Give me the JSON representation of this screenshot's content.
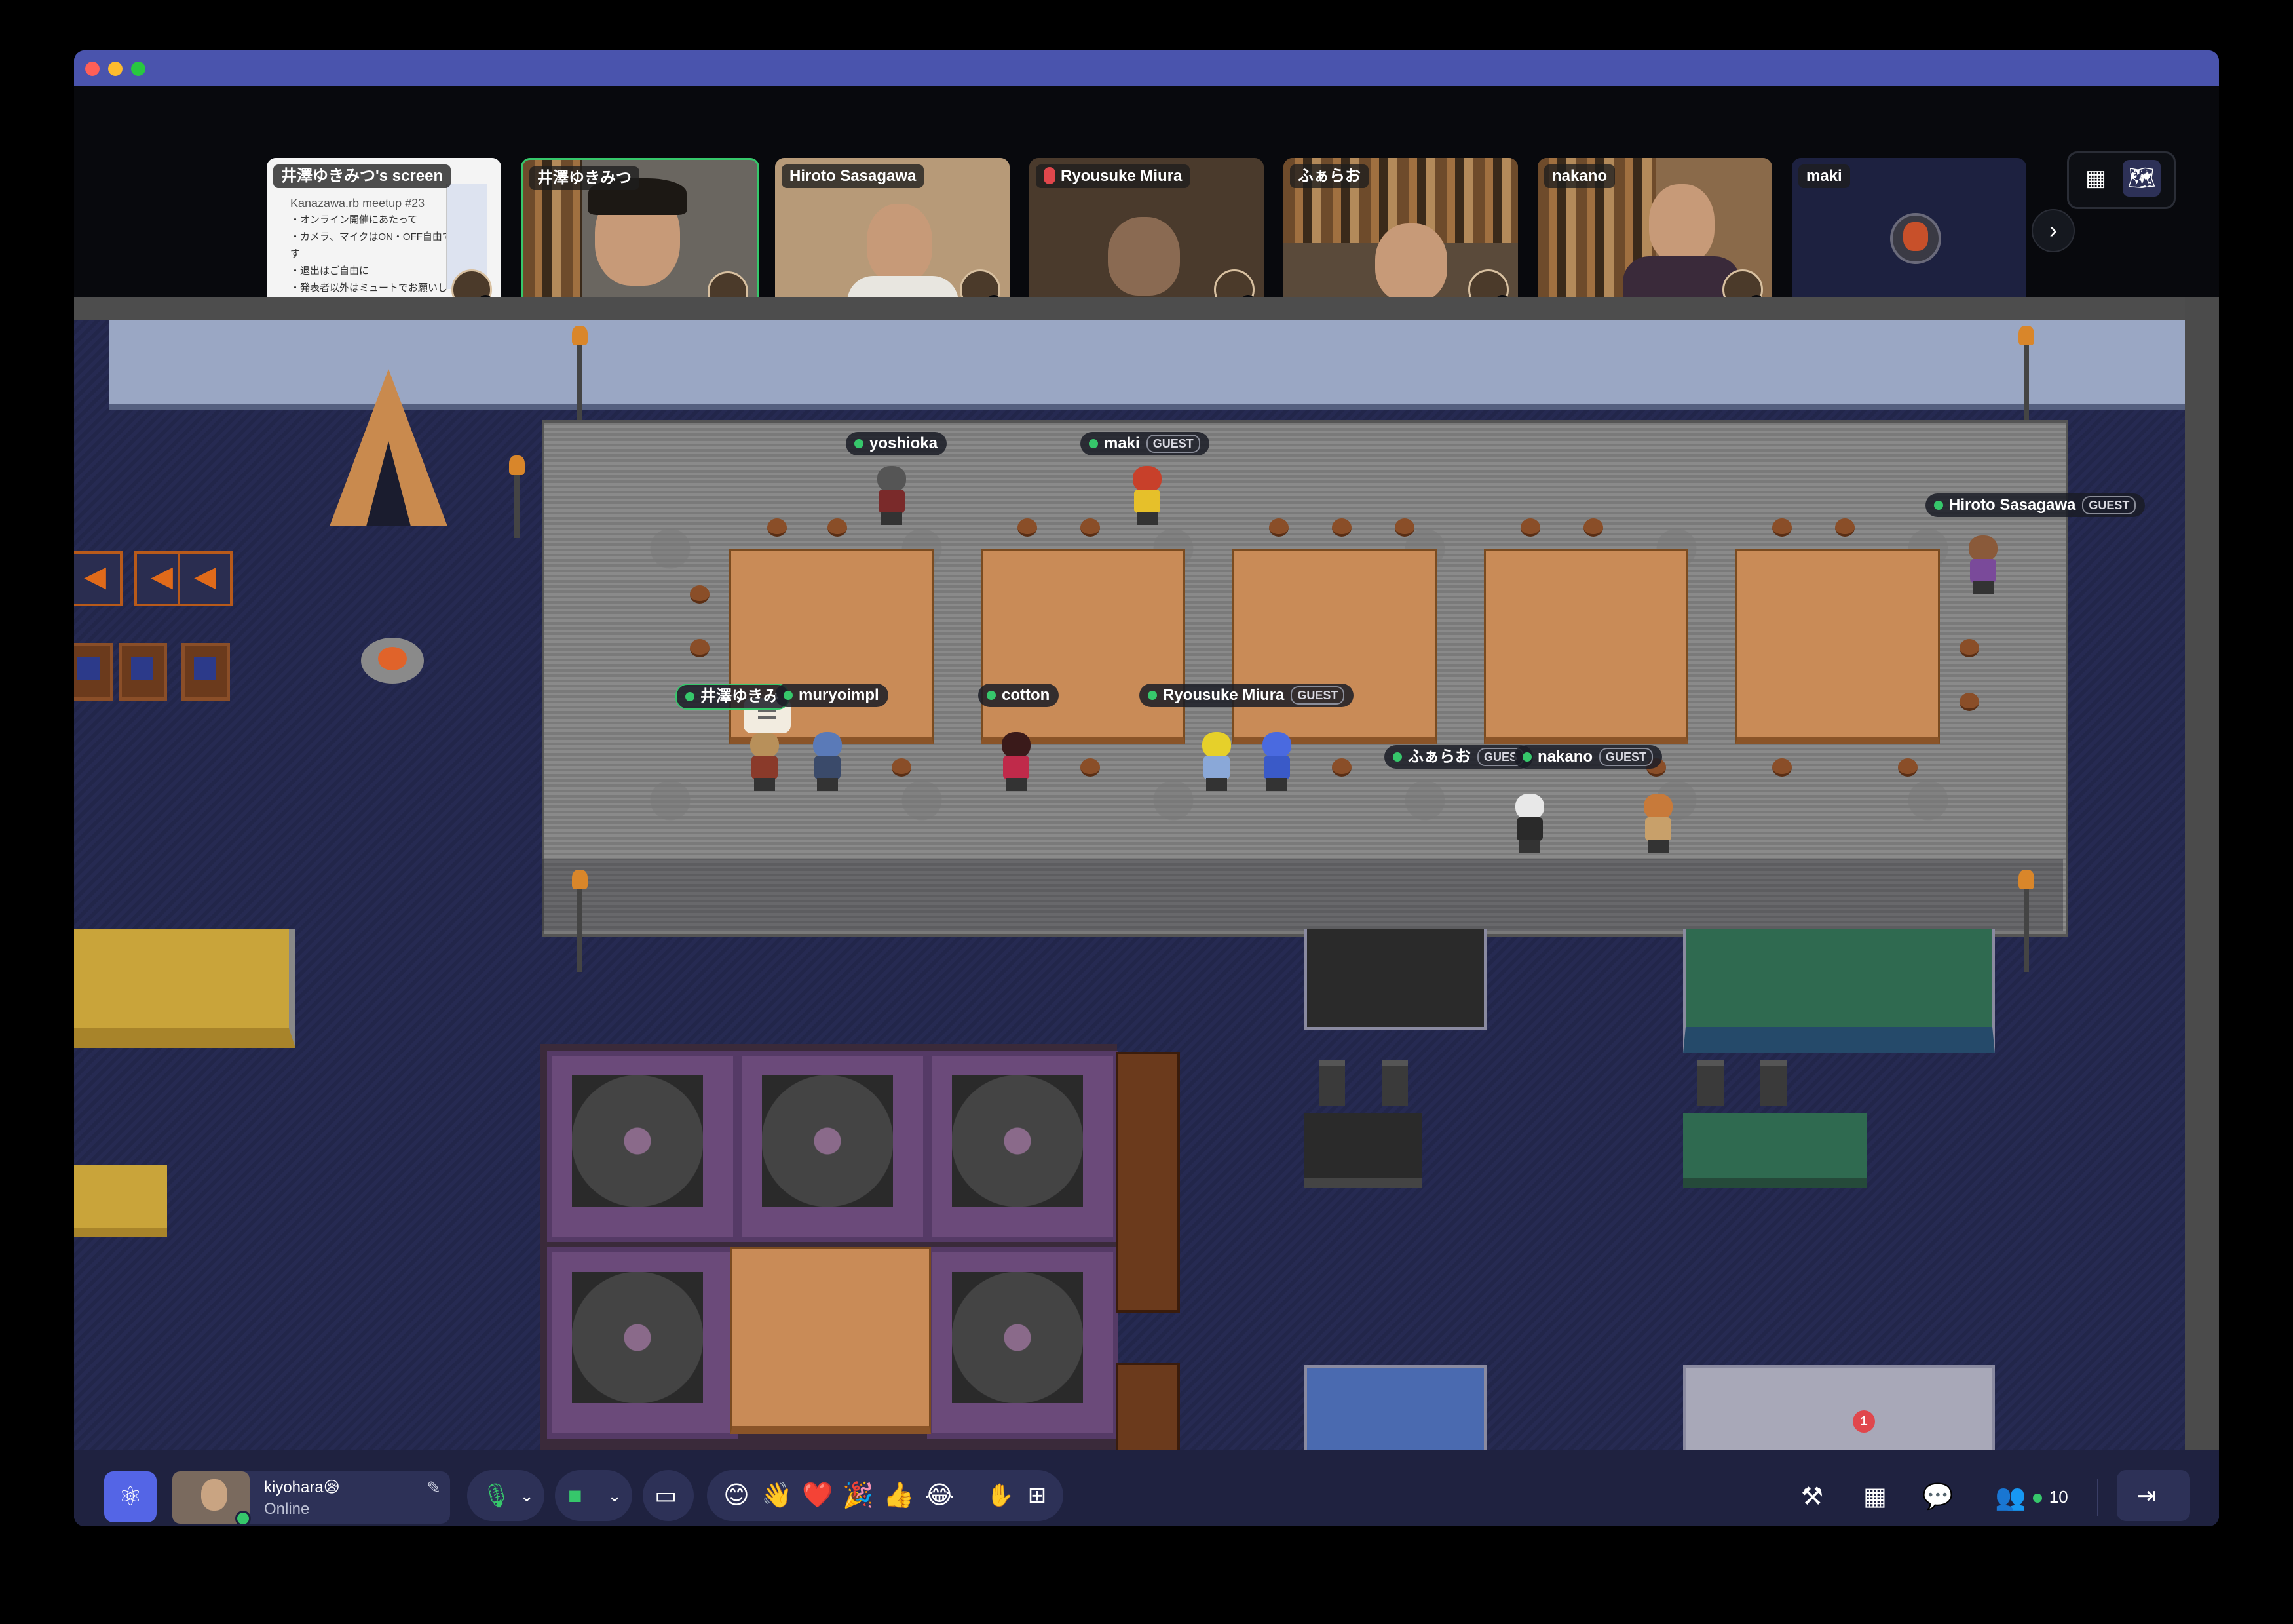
{
  "participants": [
    {
      "name": "井澤ゆきみつ's screen",
      "muted": false
    },
    {
      "name": "井澤ゆきみつ",
      "muted": false
    },
    {
      "name": "Hiroto Sasagawa",
      "muted": false
    },
    {
      "name": "Ryousuke Miura",
      "muted": true
    },
    {
      "name": "ふぁらお",
      "muted": false
    },
    {
      "name": "nakano",
      "muted": false
    },
    {
      "name": "maki",
      "muted": false
    }
  ],
  "screen_share": {
    "heading": "Kanazawa.rb meetup #23",
    "lines": [
      "・オンライン開催にあたって",
      "・カメラ、マイクはON・OFF自由です",
      "・退出はご自由に",
      "・発表者以外はミュートでお願いします"
    ]
  },
  "map_labels": {
    "yoshioka": {
      "name": "yoshioka",
      "guest": ""
    },
    "maki": {
      "name": "maki",
      "guest": "GUEST"
    },
    "hiroto": {
      "name": "Hiroto Sasagawa",
      "guest": "GUEST"
    },
    "izawa": {
      "name": "井澤ゆきみ",
      "guest": ""
    },
    "muryoimpl": {
      "name": "muryoimpl",
      "guest": ""
    },
    "cotton": {
      "name": "cotton",
      "guest": ""
    },
    "ryousuke": {
      "name": "Ryousuke Miura",
      "guest": "GUEST"
    },
    "farao": {
      "name": "ふぁらお",
      "guest": "GUES"
    },
    "nakano": {
      "name": "nakano",
      "guest": "GUEST"
    }
  },
  "me": {
    "name": "kiyohara",
    "status": "Online",
    "emoji": "😪"
  },
  "reactions": [
    "😊",
    "👋",
    "❤️",
    "🎉",
    "👍",
    "😂"
  ],
  "participant_count": "10",
  "chat_badge": "1",
  "icons": {
    "grid_view": "grid-icon",
    "map_view": "map-icon",
    "next": "chevron-right-icon",
    "mic": "microphone-icon",
    "camera": "camera-icon",
    "screen": "screen-share-icon",
    "hand": "hand-icon",
    "build": "hammer-icon",
    "calendar": "calendar-icon",
    "chat": "chat-icon",
    "people": "people-icon",
    "leave": "leave-icon"
  },
  "colors": {
    "accent": "#5465e6",
    "online": "#36c76b",
    "muted": "#e0474c"
  }
}
